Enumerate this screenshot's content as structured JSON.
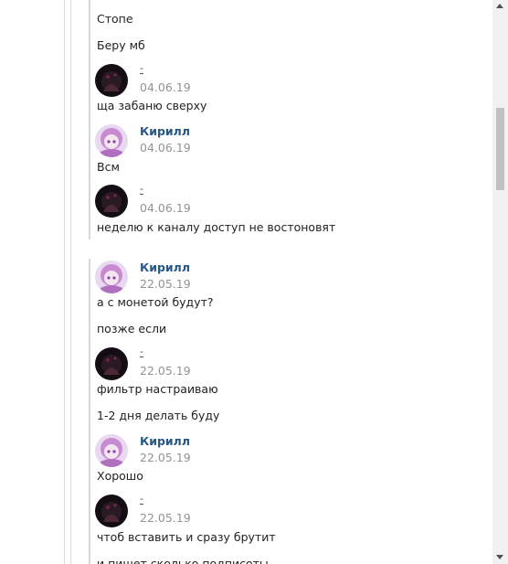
{
  "thread_1": {
    "lines": [
      "Стопе",
      "Беру мб"
    ],
    "messages": [
      {
        "author": "-",
        "date": "04.06.19",
        "text": "ща забаню сверху",
        "avatar": "dark"
      },
      {
        "author": "Кирилл",
        "date": "04.06.19",
        "text": "Всм",
        "avatar": "anime"
      },
      {
        "author": "-",
        "date": "04.06.19",
        "text": "неделю к каналу доступ не востоновят",
        "avatar": "dark"
      }
    ]
  },
  "thread_2": {
    "messages": [
      {
        "author": "Кирилл",
        "date": "22.05.19",
        "text": "а с монетой будут?",
        "extra": "позже если",
        "avatar": "anime"
      },
      {
        "author": "-",
        "date": "22.05.19",
        "text": "фильтр настраиваю",
        "extra": "1-2 дня делать буду",
        "avatar": "dark"
      },
      {
        "author": "Кирилл",
        "date": "22.05.19",
        "text": "Хорошо",
        "avatar": "anime"
      },
      {
        "author": "-",
        "date": "22.05.19",
        "text": "чтоб вставить и сразу брутит",
        "extra": "и пишет сколько подписоты",
        "avatar": "dark"
      }
    ]
  },
  "icons": {
    "scroll_up": "scroll-up-arrow-icon",
    "scroll_down": "scroll-down-arrow-icon"
  },
  "colors": {
    "author": "#2a5885",
    "date": "#939393",
    "rail": "#d3d9de"
  }
}
